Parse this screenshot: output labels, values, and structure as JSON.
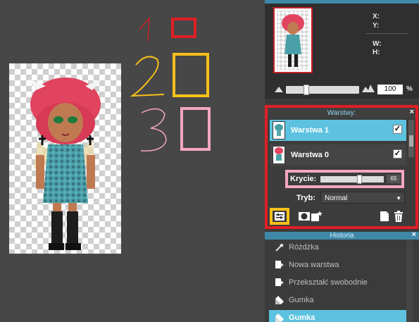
{
  "navigator": {
    "x_label": "X:",
    "y_label": "Y:",
    "w_label": "W:",
    "h_label": "H:",
    "zoom_value": "100",
    "zoom_unit": "%"
  },
  "annotations": {
    "one": "1",
    "two": "2",
    "three": "3",
    "color_red": "#e01e25",
    "color_yellow": "#f6c01a",
    "color_pink": "#f5a6c0"
  },
  "layers": {
    "title": "Warstwy:",
    "close": "×",
    "items": [
      {
        "label": "Warstwa 1",
        "selected": true,
        "visible": true
      },
      {
        "label": "Warstwa 0",
        "selected": false,
        "visible": true
      }
    ],
    "opacity_label": "Krycie:",
    "opacity_value": "65",
    "mode_label": "Tryb:",
    "mode_value": "Normal"
  },
  "history": {
    "title": "Historia",
    "close": "×",
    "items": [
      {
        "label": "Różdżka",
        "icon": "wand-icon"
      },
      {
        "label": "Nowa warstwa",
        "icon": "new-layer-icon"
      },
      {
        "label": "Przekształć swobodnie",
        "icon": "transform-icon"
      },
      {
        "label": "Gumka",
        "icon": "eraser-icon"
      },
      {
        "label": "Gumka",
        "icon": "eraser-icon",
        "selected": true
      }
    ]
  }
}
